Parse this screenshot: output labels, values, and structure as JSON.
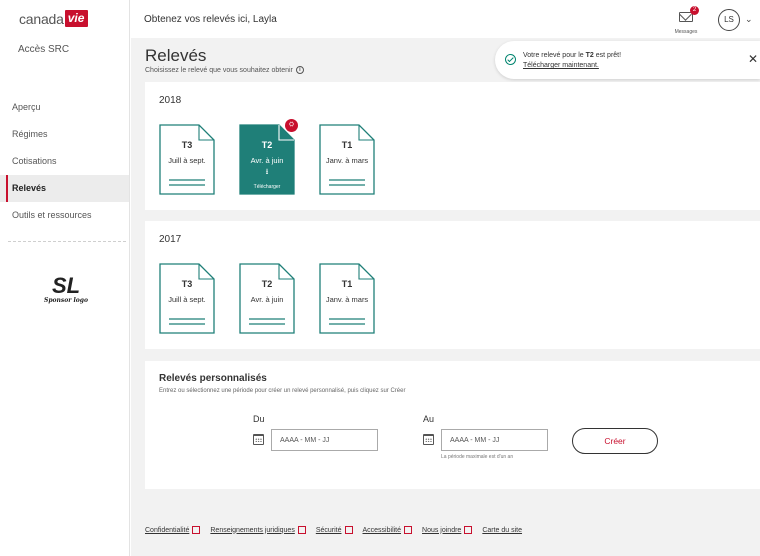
{
  "brand": {
    "name": "canada",
    "vie": "vie",
    "accent": "#c8102e",
    "teal": "#1f7f78"
  },
  "sidebar": {
    "account": "Accès SRC",
    "items": [
      {
        "label": "Aperçu",
        "active": false
      },
      {
        "label": "Régimes",
        "active": false
      },
      {
        "label": "Cotisations",
        "active": false
      },
      {
        "label": "Relevés",
        "active": true
      },
      {
        "label": "Outils et ressources",
        "active": false
      }
    ],
    "sponsor": {
      "mark": "SL",
      "text": "Sponsor logo"
    }
  },
  "header": {
    "greeting": "Obtenez vos relevés ici, Layla",
    "messages_count": "2",
    "messages_label": "Messages",
    "avatar_initials": "LS"
  },
  "page": {
    "title": "Relevés",
    "subtitle": "Choisissez le relevé que vous souhaitez obtenir",
    "info_icon": "i"
  },
  "toast": {
    "text_before": "Votre relevé pour le ",
    "text_bold": "T2",
    "text_after": " est prêt!",
    "link": "Télécharger maintenant.",
    "close": "✕"
  },
  "years": [
    {
      "year": "2018",
      "statements": [
        {
          "quarter": "T3",
          "period": "Juill à sept.",
          "ready": false
        },
        {
          "quarter": "T2",
          "period": "Avr. à juin",
          "ready": true,
          "download_label": "Télécharger",
          "badge": "PDF"
        },
        {
          "quarter": "T1",
          "period": "Janv. à mars",
          "ready": false
        }
      ]
    },
    {
      "year": "2017",
      "statements": [
        {
          "quarter": "T3",
          "period": "Juill à sept.",
          "ready": false
        },
        {
          "quarter": "T2",
          "period": "Avr. à juin",
          "ready": false
        },
        {
          "quarter": "T1",
          "period": "Janv. à mars",
          "ready": false
        }
      ]
    }
  ],
  "custom": {
    "title": "Relevés personnalisés",
    "subtitle": "Entrez ou sélectionnez une période pour créer un relevé personnalisé, puis cliquez sur Créer",
    "from_label": "Du",
    "to_label": "Au",
    "from_placeholder": "AAAA - MM - JJ",
    "to_placeholder": "AAAA - MM - JJ",
    "hint": "La période maximale est d'un an",
    "create_label": "Créer"
  },
  "footer": {
    "links": [
      {
        "label": "Confidentialité",
        "external": true
      },
      {
        "label": "Renseignements juridiques",
        "external": true
      },
      {
        "label": "Sécurité",
        "external": true
      },
      {
        "label": "Accessibilité",
        "external": true
      },
      {
        "label": "Nous joindre",
        "external": true
      },
      {
        "label": "Carte du site",
        "external": false
      }
    ]
  }
}
